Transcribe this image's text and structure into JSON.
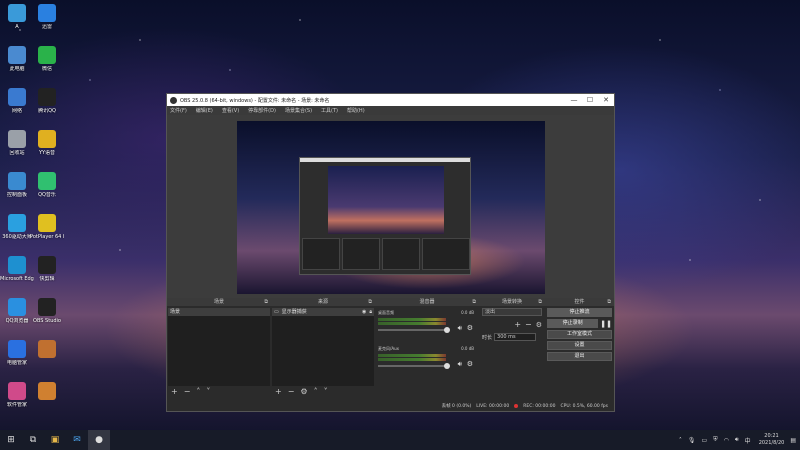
{
  "desktop": {
    "icons_left": [
      {
        "label": "A",
        "color": "#3a9ad9"
      },
      {
        "label": "此电脑",
        "color": "#4a8ad0"
      },
      {
        "label": "网络",
        "color": "#3a7ad0"
      },
      {
        "label": "回收站",
        "color": "#9aa0a8"
      },
      {
        "label": "控制面板",
        "color": "#3a8ad0"
      },
      {
        "label": "360驱动大师",
        "color": "#2aa0e0"
      },
      {
        "label": "Microsoft Edge",
        "color": "#1e90d0"
      },
      {
        "label": "QQ浏览器",
        "color": "#2a90e0"
      },
      {
        "label": "电脑管家",
        "color": "#2a70e0"
      },
      {
        "label": "软件管家",
        "color": "#d04a8a"
      }
    ],
    "icons_right": [
      {
        "label": "迅雷",
        "color": "#2a80e0"
      },
      {
        "label": "微信",
        "color": "#2ab24a"
      },
      {
        "label": "腾讯QQ",
        "color": "#222222"
      },
      {
        "label": "YY语音",
        "color": "#e0b020"
      },
      {
        "label": "QQ音乐",
        "color": "#30c070"
      },
      {
        "label": "PotPlayer 64 bit",
        "color": "#e0c020"
      },
      {
        "label": "快剪辑",
        "color": "#222222"
      },
      {
        "label": "OBS Studio",
        "color": "#222222"
      },
      {
        "label": "",
        "color": "#c07030"
      },
      {
        "label": "",
        "color": "#d08030"
      }
    ]
  },
  "obs": {
    "title": "OBS 25.0.8 (64-bit, windows) - 配置文件: 未命名 - 场景: 未命名",
    "window_buttons": {
      "minimize": "—",
      "maximize": "☐",
      "close": "✕"
    },
    "menu": [
      "文件(F)",
      "编辑(E)",
      "查看(V)",
      "停靠部件(D)",
      "场景集合(S)",
      "工具(T)",
      "帮助(H)"
    ],
    "docks": {
      "scenes": {
        "title": "场景",
        "items": [
          "场景"
        ]
      },
      "sources": {
        "title": "来源",
        "items": [
          "显示器捕获"
        ]
      },
      "mixer": {
        "title": "混音器",
        "tracks": [
          {
            "name": "桌面音频",
            "db": "0.0 dB"
          },
          {
            "name": "麦克风/Aux",
            "db": "0.0 dB"
          }
        ]
      },
      "transitions": {
        "title": "场景转换",
        "type": "淡出",
        "duration_label": "时长",
        "duration_value": "300 ms"
      },
      "controls": {
        "title": "控件",
        "buttons": [
          "停止推流",
          "停止录制",
          "工作室模式",
          "设置",
          "退出"
        ]
      }
    },
    "status": {
      "dropped": "丢帧 0 (0.0%)",
      "live": "LIVE: 00:00:00",
      "rec": "REC: 00:00:00",
      "cpu": "CPU: 0.5%, 60.00 fps"
    }
  },
  "taskbar": {
    "clock_time": "20:21",
    "clock_date": "2021/8/20"
  }
}
